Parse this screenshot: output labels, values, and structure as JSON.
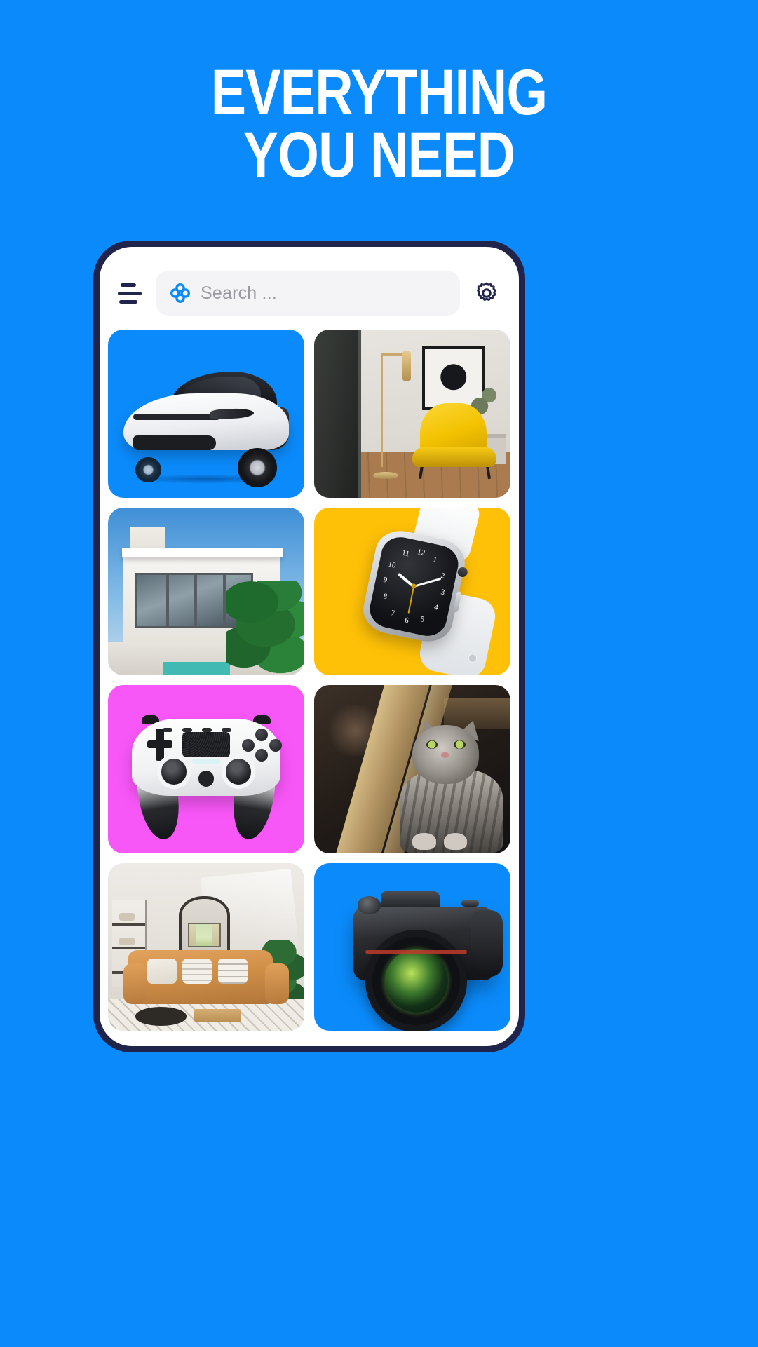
{
  "page": {
    "background_color": "#0b8bfb",
    "accent_color": "#0b8bfb",
    "frame_color": "#21244a",
    "headline_line1": "EVERYTHING",
    "headline_line2": "YOU NEED"
  },
  "app": {
    "topbar": {
      "menu_icon": "hamburger-menu-icon",
      "brand_icon": "clover-flower-icon",
      "search_placeholder": "Search ...",
      "search_value": "",
      "settings_icon": "gear-icon"
    },
    "grid": {
      "tiles": [
        {
          "id": "car",
          "label": "Electric car on blue background",
          "bg": "#0b8bfb"
        },
        {
          "id": "interior",
          "label": "Interior with yellow armchair",
          "bg": "#e8e5e0"
        },
        {
          "id": "house",
          "label": "Modern house with glass facade",
          "bg": "#86bde6"
        },
        {
          "id": "watch",
          "label": "Smartwatch on amber background",
          "bg": "#ffc107"
        },
        {
          "id": "controller",
          "label": "Game controller on pink background",
          "bg": "#f857f8"
        },
        {
          "id": "cat",
          "label": "Tabby cat on wooden cat tree",
          "bg": "#241d18"
        },
        {
          "id": "livingroom",
          "label": "Living room with tan sofa and mirror",
          "bg": "#eeebe6"
        },
        {
          "id": "camera",
          "label": "DSLR camera on blue background",
          "bg": "#0b8bfb"
        }
      ]
    }
  }
}
